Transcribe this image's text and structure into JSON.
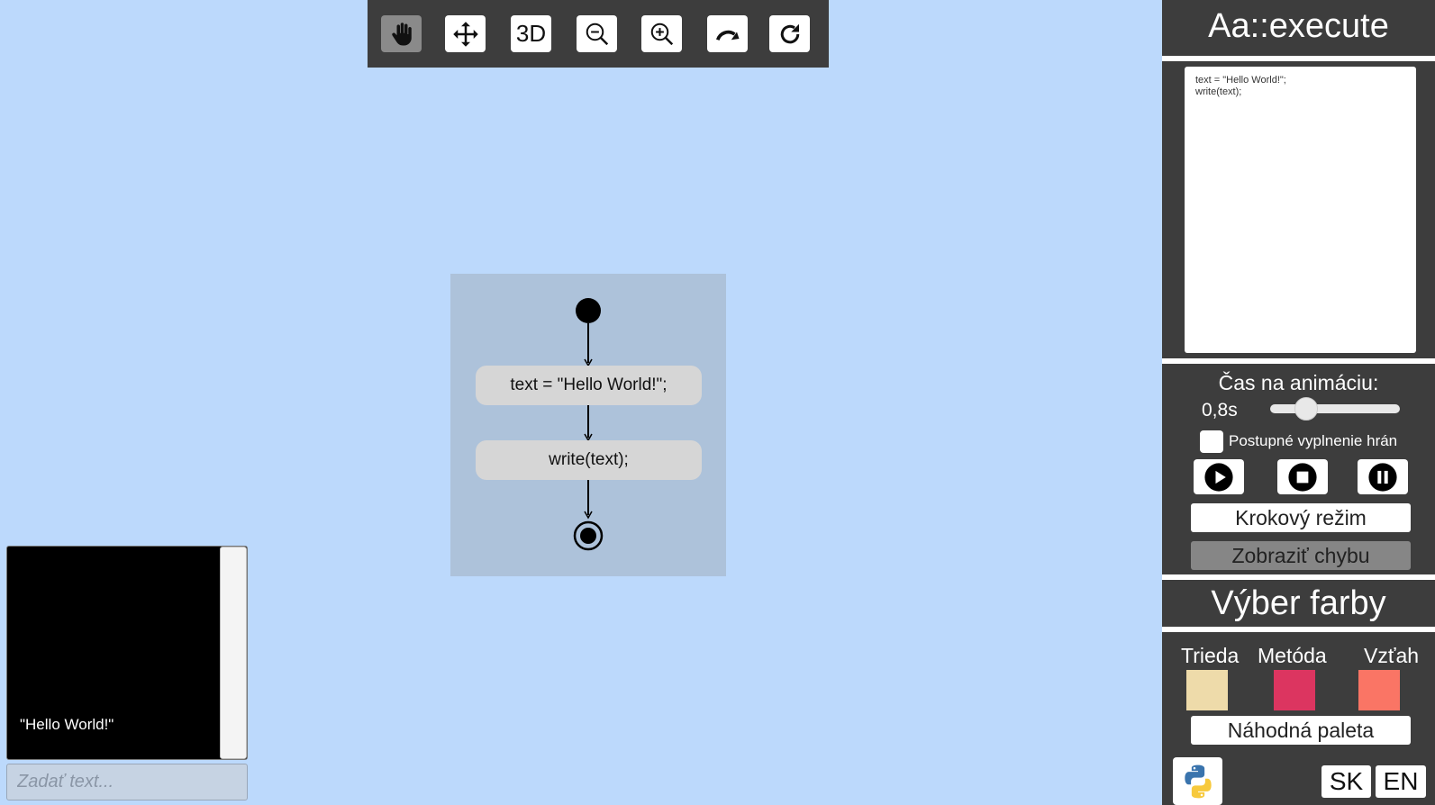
{
  "toolbar": {
    "tools": [
      {
        "id": "hand",
        "icon": "hand-icon",
        "active": true
      },
      {
        "id": "move",
        "icon": "move-arrows-icon",
        "active": false
      },
      {
        "id": "3d",
        "label": "3D",
        "active": false
      },
      {
        "id": "zoom-out",
        "icon": "zoom-out-icon",
        "active": false
      },
      {
        "id": "zoom-in",
        "icon": "zoom-in-icon",
        "active": false
      },
      {
        "id": "redo",
        "icon": "redo-arrow-icon",
        "active": false
      },
      {
        "id": "refresh",
        "icon": "refresh-icon",
        "active": false
      }
    ],
    "label_3d": "3D"
  },
  "diagram": {
    "nodes": [
      {
        "type": "initial"
      },
      {
        "type": "action",
        "label": "text = \"Hello World!\";"
      },
      {
        "type": "action",
        "label": "write(text);"
      },
      {
        "type": "final"
      }
    ]
  },
  "console": {
    "output": "\"Hello World!\"",
    "input_placeholder": "Zadať text..."
  },
  "panel": {
    "title": "Aa::execute",
    "code": "text = \"Hello World!\";\nwrite(text);",
    "animation": {
      "label": "Čas na animáciu:",
      "value_text": "0,8s",
      "slider_fraction": 0.28
    },
    "gradual_fill": {
      "label": "Postupné vyplnenie hrán",
      "checked": false
    },
    "controls": [
      {
        "id": "play",
        "icon": "play-icon"
      },
      {
        "id": "stop",
        "icon": "stop-icon"
      },
      {
        "id": "pause",
        "icon": "pause-icon"
      }
    ],
    "step_mode_label": "Krokový režim",
    "show_error_label": "Zobraziť chybu",
    "color_title": "Výber farby",
    "colors": [
      {
        "label": "Trieda",
        "hex": "#eedbaa"
      },
      {
        "label": "Metóda",
        "hex": "#dc3560"
      },
      {
        "label": "Vzťah",
        "hex": "#fa7565"
      }
    ],
    "random_palette_label": "Náhodná paleta",
    "languages": [
      "SK",
      "EN"
    ]
  },
  "colors": {
    "background": "#bcd9fc",
    "panel": "#3d3d3d",
    "diagram_bg": "#adc2da",
    "node_bg": "#d6d6d6"
  }
}
